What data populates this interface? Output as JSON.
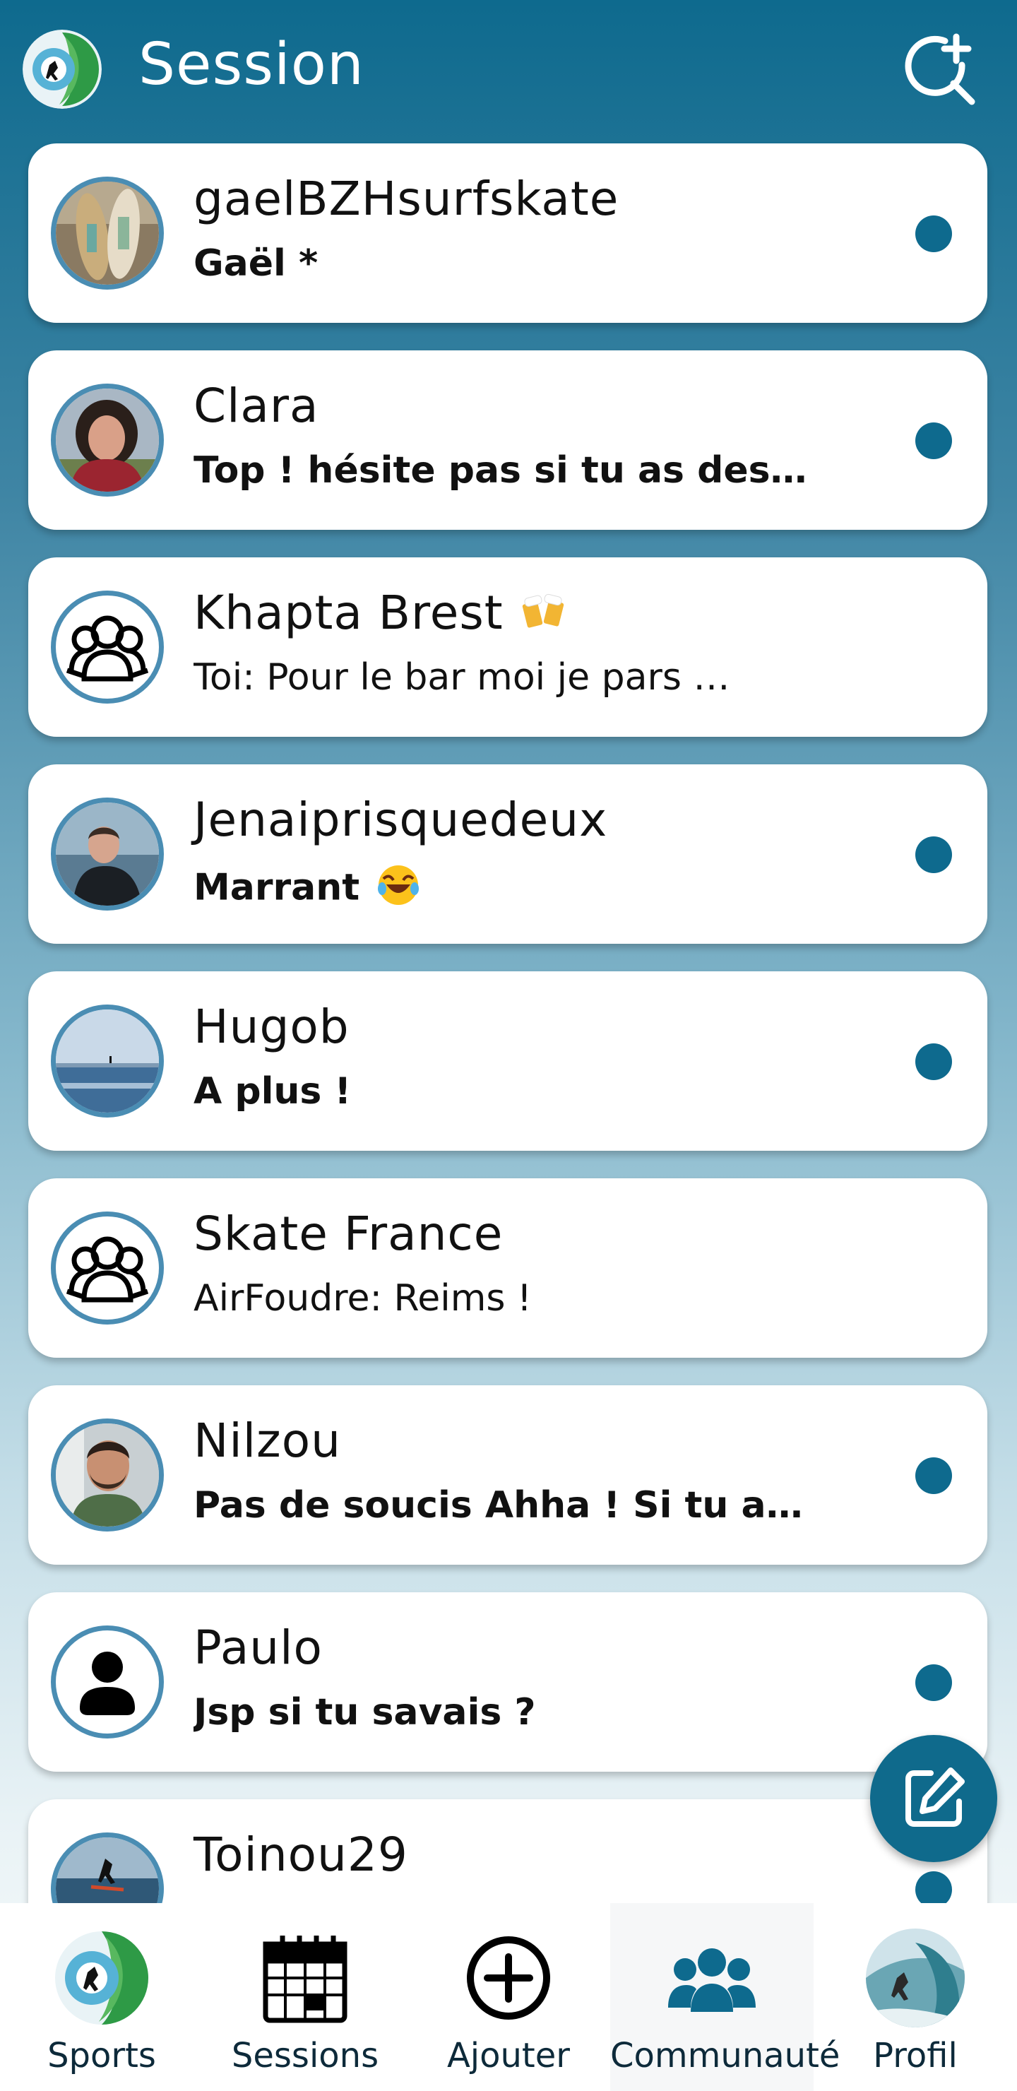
{
  "header": {
    "title": "Session"
  },
  "conversations": [
    {
      "name": "gaelBZHsurfskate",
      "preview": "Gaël *",
      "unread": true,
      "avatar": "skateboards-photo"
    },
    {
      "name": "Clara",
      "preview": "Top ! hésite pas si tu as des…",
      "unread": true,
      "avatar": "woman-photo"
    },
    {
      "name": "Khapta Brest",
      "preview": "Toi: Pour le bar moi je pars …",
      "unread": false,
      "avatar": "group-icon",
      "emoji": "beer-mugs-emoji"
    },
    {
      "name": "Jenaiprisquedeux",
      "preview": "Marrant",
      "unread": true,
      "avatar": "surfer-photo",
      "emoji": "laughing-emoji"
    },
    {
      "name": "Hugob",
      "preview": "A plus !",
      "unread": true,
      "avatar": "sea-photo"
    },
    {
      "name": "Skate France",
      "preview": "AirFoudre: Reims !",
      "unread": false,
      "avatar": "group-icon"
    },
    {
      "name": "Nilzou",
      "preview": "Pas de soucis Ahha ! Si tu a…",
      "unread": true,
      "avatar": "man-photo"
    },
    {
      "name": "Paulo",
      "preview": "Jsp si tu savais ?",
      "unread": true,
      "avatar": "person-icon"
    },
    {
      "name": "Toinou29",
      "preview": "",
      "unread": true,
      "avatar": "kite-photo"
    }
  ],
  "nav": {
    "sports": "Sports",
    "sessions": "Sessions",
    "ajouter": "Ajouter",
    "communaute": "Communauté",
    "profil": "Profil"
  },
  "colors": {
    "primary": "#0e6a8e",
    "avatar_ring": "#4a8db3"
  }
}
